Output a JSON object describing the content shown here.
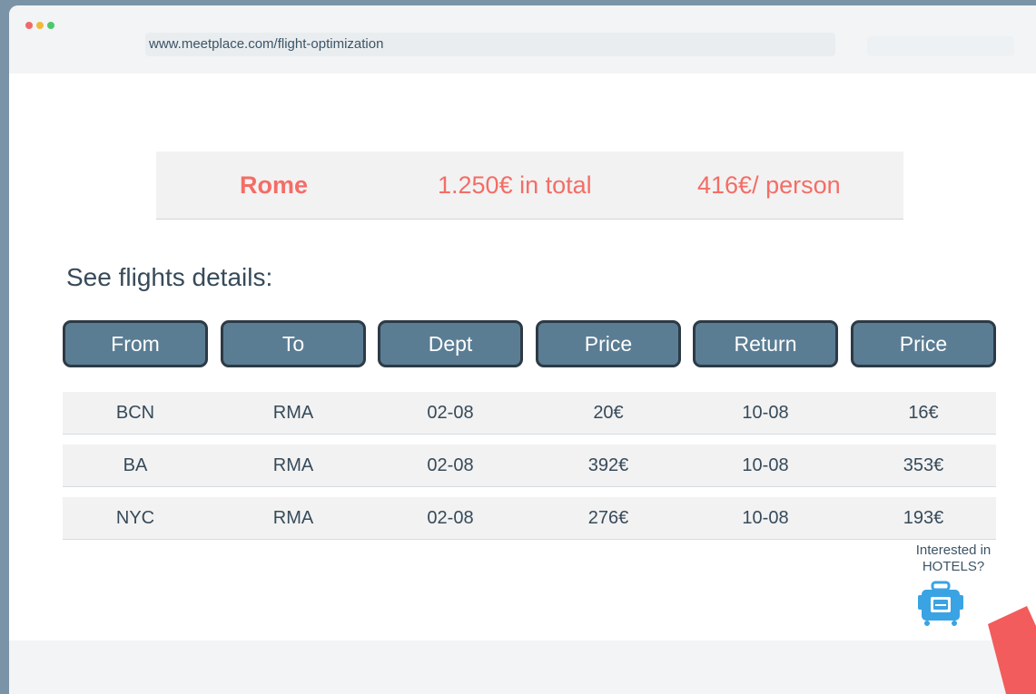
{
  "browser": {
    "url": "www.meetplace.com/flight-optimization"
  },
  "summary": {
    "city": "Rome",
    "total": "1.250€ in total",
    "per_person": "416€/ person"
  },
  "section_title": "See flights details:",
  "table": {
    "headers": [
      "From",
      "To",
      "Dept",
      "Price",
      "Return",
      "Price"
    ],
    "rows": [
      [
        "BCN",
        "RMA",
        "02-08",
        "20€",
        "10-08",
        "16€"
      ],
      [
        "BA",
        "RMA",
        "02-08",
        "392€",
        "10-08",
        "353€"
      ],
      [
        "NYC",
        "RMA",
        "02-08",
        "276€",
        "10-08",
        "193€"
      ]
    ]
  },
  "hotels": {
    "line1": "Interested in",
    "line2": "HOTELS?",
    "icon": "suitcase-icon"
  },
  "colors": {
    "accent": "#f46d66",
    "header_button": "#5a7d93",
    "header_border": "#2d3a45",
    "text": "#364a5a",
    "suitcase": "#3aa3e3"
  }
}
